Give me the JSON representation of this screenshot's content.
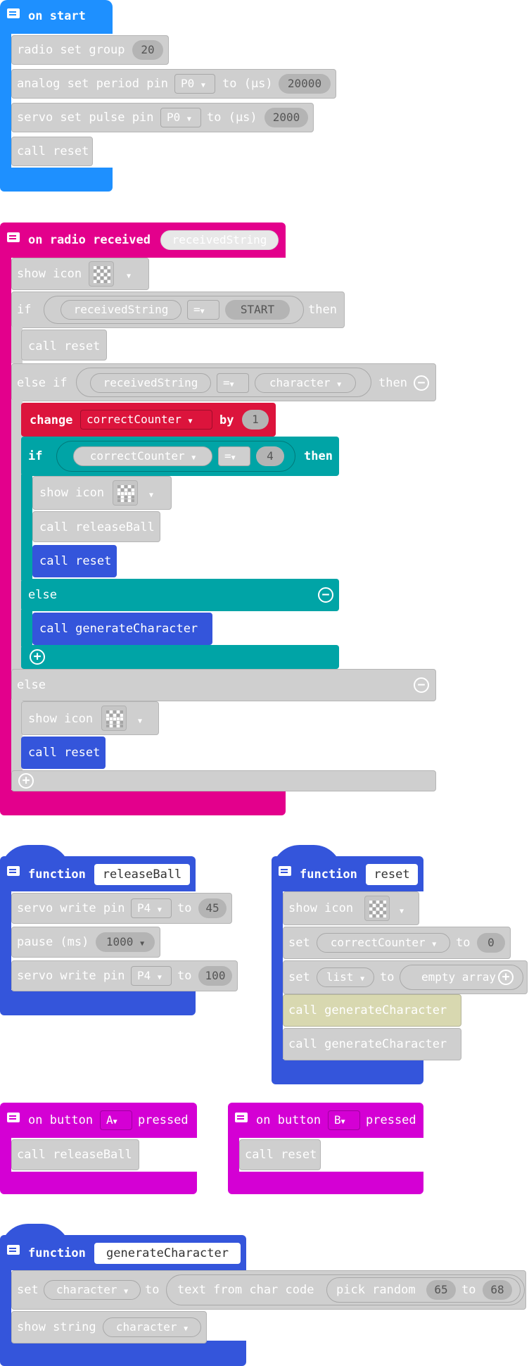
{
  "colors": {
    "basic_blue": "#1e90ff",
    "radio_pink": "#e3008c",
    "function_blue": "#3455db",
    "input_magenta": "#d400d4",
    "logic_teal": "#00a4a6",
    "variables_red": "#dc143c",
    "disabled_gray": "#cfcfcf"
  },
  "on_start": {
    "header": "on start",
    "radio_set_group": "radio set group",
    "group_value": "20",
    "analog_set_period": "analog set period pin",
    "analog_pin": "P0",
    "analog_to": "to (µs)",
    "analog_value": "20000",
    "servo_set_pulse": "servo set pulse pin",
    "servo_pin": "P0",
    "servo_to": "to (µs)",
    "servo_value": "2000",
    "call_reset": "call reset"
  },
  "radio": {
    "header": "on radio received",
    "param": "receivedString",
    "show_icon": "show icon",
    "if_label": "if",
    "if_lhs": "receivedString",
    "if_op": "=",
    "if_rhs": "START",
    "then1": "then",
    "call_reset_1": "call reset",
    "else_if": "else if",
    "elif_lhs": "receivedString",
    "elif_op": "=",
    "elif_rhs": "character",
    "then2": "then",
    "change": "change",
    "change_var": "correctCounter",
    "by": "by",
    "by_value": "1",
    "inner_if": "if",
    "inner_lhs": "correctCounter",
    "inner_op": "=",
    "inner_rhs": "4",
    "inner_then": "then",
    "inner_show_icon": "show icon",
    "call_release": "call releaseBall",
    "call_reset_2": "call reset",
    "inner_else": "else",
    "call_generate": "call generateCharacter",
    "else": "else",
    "else_show_icon": "show icon",
    "call_reset_3": "call reset"
  },
  "release_fn": {
    "function": "function",
    "name": "releaseBall",
    "servo_write_1": "servo write pin",
    "pin1": "P4",
    "to1": "to",
    "val1": "45",
    "pause": "pause (ms)",
    "pause_val": "1000",
    "servo_write_2": "servo write pin",
    "pin2": "P4",
    "to2": "to",
    "val2": "100"
  },
  "reset_fn": {
    "function": "function",
    "name": "reset",
    "show_icon": "show icon",
    "set1": "set",
    "var1": "correctCounter",
    "to1": "to",
    "val1": "0",
    "set2": "set",
    "var2": "list",
    "to2": "to",
    "empty_array": "empty array",
    "call_generate_1": "call generateCharacter",
    "call_generate_2": "call generateCharacter"
  },
  "button_a": {
    "on": "on button",
    "button": "A",
    "pressed": "pressed",
    "call": "call releaseBall"
  },
  "button_b": {
    "on": "on button",
    "button": "B",
    "pressed": "pressed",
    "call": "call reset"
  },
  "gen_fn": {
    "function": "function",
    "name": "generateCharacter",
    "set": "set",
    "var": "character",
    "to": "to",
    "text_from": "text from char code",
    "pick_random": "pick random",
    "min": "65",
    "to2": "to",
    "max": "68",
    "show_string": "show string",
    "show_var": "character"
  },
  "icons": {
    "comment": "comment-icon",
    "dropdown": "triangle-down-icon",
    "plus": "plus-circle-icon",
    "minus": "minus-circle-icon",
    "led": "led-grid-icon"
  }
}
